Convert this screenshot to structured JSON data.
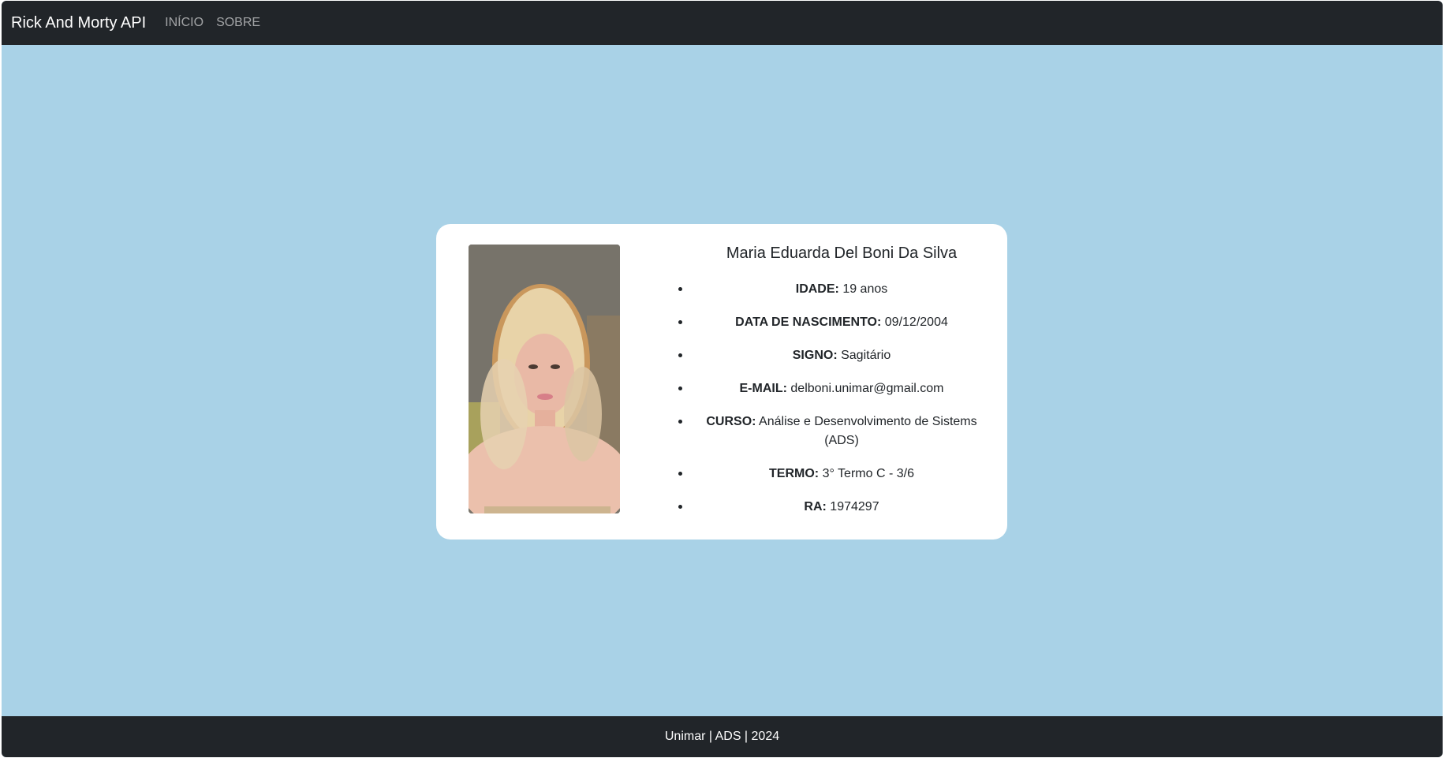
{
  "navbar": {
    "brand": "Rick And Morty API",
    "links": [
      "INÍCIO",
      "SOBRE"
    ]
  },
  "profile": {
    "name": "Maria Eduarda Del Boni Da Silva",
    "photo_alt": "photo",
    "details": [
      {
        "label": "IDADE:",
        "value": "19 anos"
      },
      {
        "label": "DATA DE NASCIMENTO:",
        "value": "09/12/2004"
      },
      {
        "label": "SIGNO:",
        "value": "Sagitário"
      },
      {
        "label": "E-MAIL:",
        "value": "delboni.unimar@gmail.com"
      },
      {
        "label": "CURSO:",
        "value": "Análise e Desenvolvimento de Sistems (ADS)"
      },
      {
        "label": "TERMO:",
        "value": "3° Termo C - 3/6"
      },
      {
        "label": "RA:",
        "value": "1974297"
      }
    ]
  },
  "footer": {
    "text": "Unimar | ADS | 2024"
  },
  "colors": {
    "navbar_bg": "#212529",
    "page_bg": "#a9d2e7",
    "card_bg": "#ffffff"
  }
}
